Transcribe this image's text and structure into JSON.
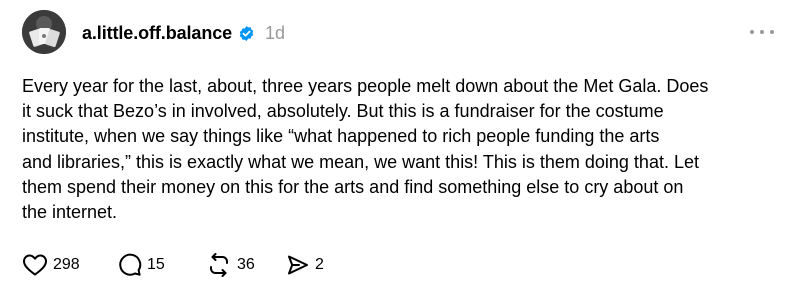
{
  "post": {
    "username": "a.little.off.balance",
    "timestamp": "1d",
    "body_lines": [
      "Every year for the last, about, three years people melt down about the Met Gala. Does",
      "it suck that Bezo’s in involved, absolutely. But this is a fundraiser for the costume",
      "institute, when we say things like “what happened to rich people funding the arts",
      "and libraries,” this is exactly what we mean, we want this! This is them doing that. Let",
      "them spend their money on this for the arts and find something else to cry about on",
      "the internet."
    ],
    "verified_color": "#0095f6"
  },
  "actions": {
    "likes": "298",
    "replies": "15",
    "reposts": "36",
    "shares": "2"
  },
  "icons": {
    "avatar": "avatar-image",
    "verified": "verified-badge-icon",
    "more": "more-options-icon",
    "like": "heart-icon",
    "reply": "comment-bubble-icon",
    "repost": "repost-arrows-icon",
    "share": "send-arrow-icon"
  }
}
